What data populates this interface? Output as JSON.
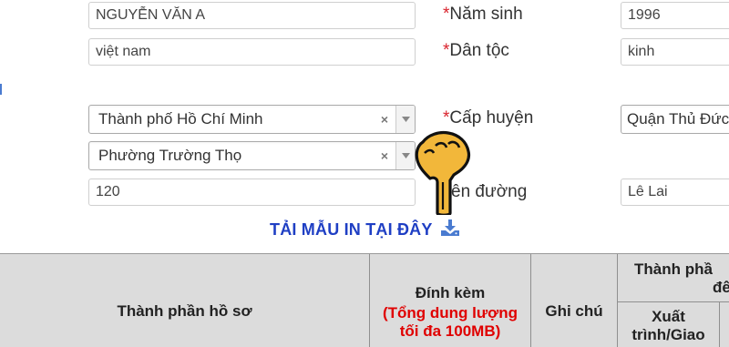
{
  "form": {
    "full_name": "NGUYỄN VĂN A",
    "birth_year_label": "Năm sinh",
    "birth_year": "1996",
    "nationality": "việt nam",
    "ethnicity_label": "Dân tộc",
    "ethnicity": "kinh",
    "province": "Thành phố Hồ Chí Minh",
    "district_label": "Cấp huyện",
    "district": "Quận Thủ Đức",
    "ward": "Phường Trường Thọ",
    "house_number": "120",
    "street_label_partial": "ên đường",
    "street": "Lê Lai",
    "required_mark": "*",
    "clear_symbol": "×"
  },
  "download": {
    "label": "TẢI MẪU IN TẠI ĐÂY",
    "icon": "download-icon",
    "color": "#1f3fc4"
  },
  "cursor": {
    "icon": "hand-pointer-icon"
  },
  "table": {
    "col_documents": "Thành phần hồ sơ",
    "col_attachment": "Đính kèm",
    "col_attachment_note": "(Tổng dung lượng tối đa 100MB)",
    "col_note": "Ghi chú",
    "col_components_partial": "Thành phầ",
    "col_components_partial2": "đê",
    "col_submit_partial": "Xuất trình/Giao",
    "note_color": "#e00000"
  }
}
